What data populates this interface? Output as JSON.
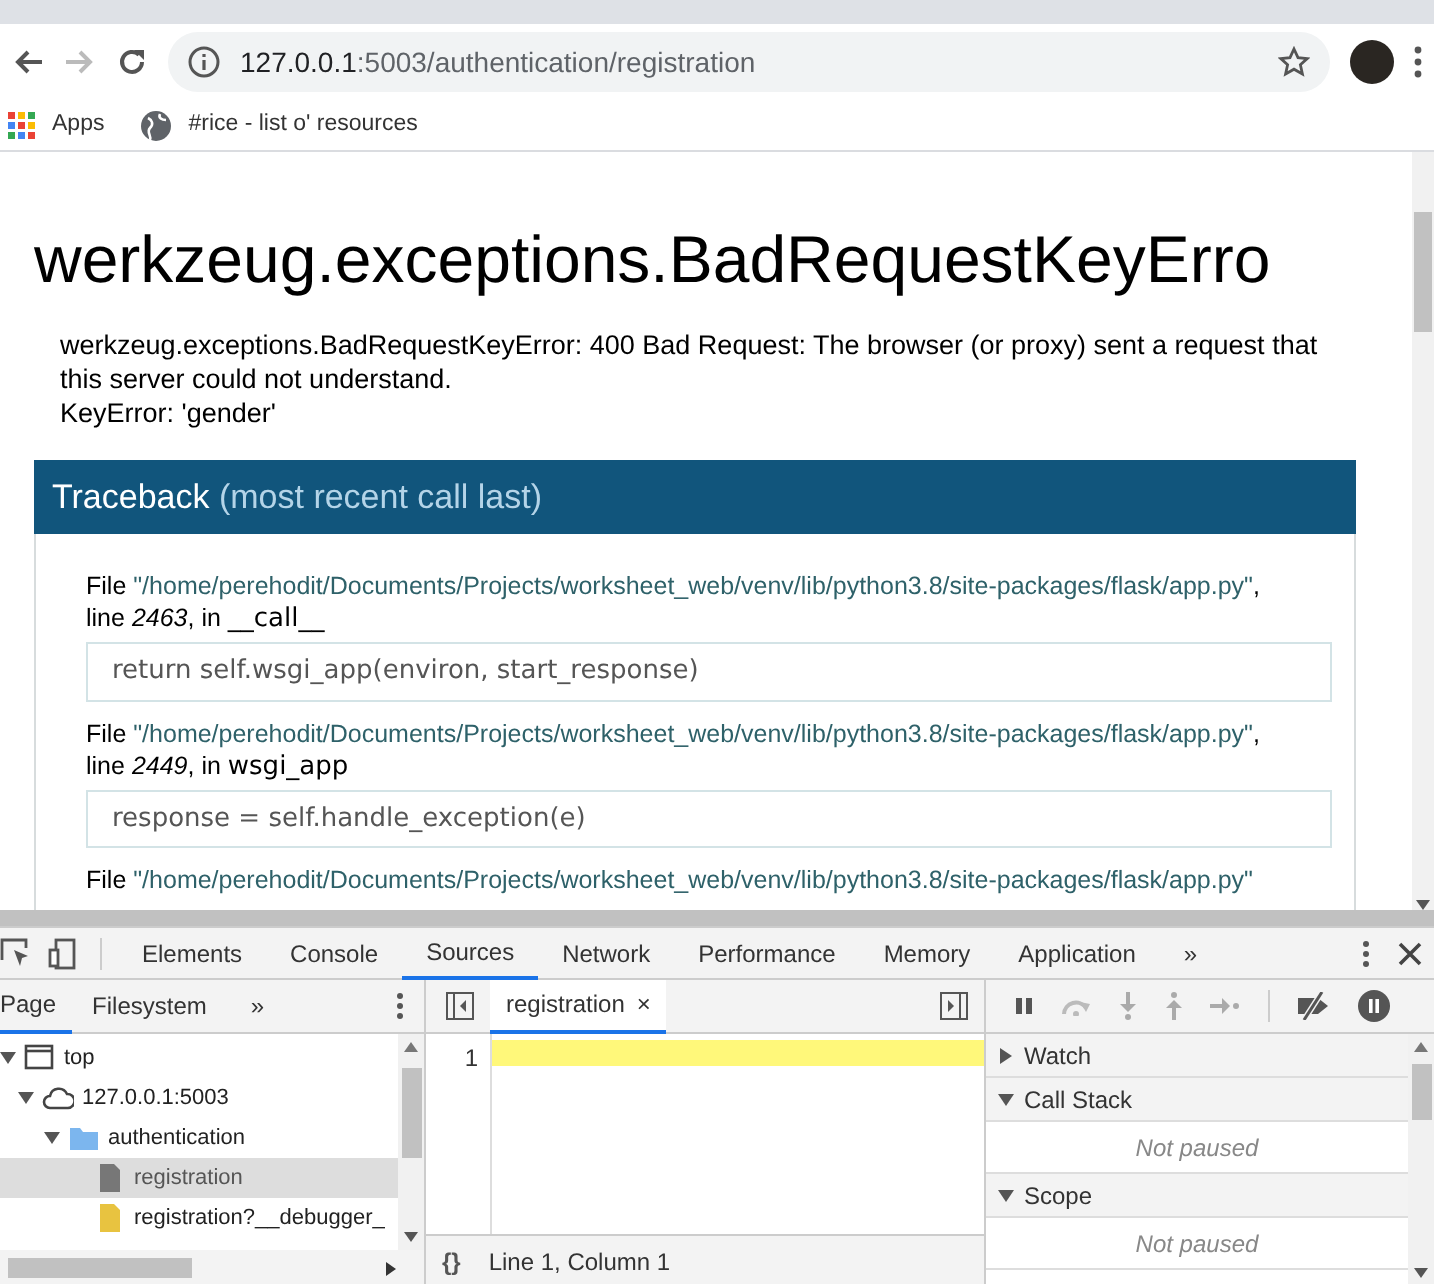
{
  "browser": {
    "url_host": "127.0.0.1",
    "url_rest": ":5003/authentication/registration",
    "bookmarks": [
      {
        "kind": "apps",
        "label": "Apps"
      },
      {
        "kind": "globe",
        "label": "#rice - list o' resources"
      }
    ]
  },
  "page": {
    "title": "werkzeug.exceptions.BadRequestKeyErro",
    "message": [
      "werkzeug.exceptions.BadRequestKeyError: 400 Bad Request: The browser (or proxy) sent a request that this server could not understand.",
      "KeyError: 'gender'"
    ],
    "traceback": {
      "heading": "Traceback",
      "note": "(most recent call last)",
      "frames": [
        {
          "file_label": "File",
          "path": "\"/home/perehodit/Documents/Projects/worksheet_web/venv/lib/python3.8/site-packages/flask/app.py\"",
          "line_label": ", line",
          "line": "2463",
          "in_label": ", in",
          "function": "__call__",
          "code": "return self.wsgi_app(environ, start_response)"
        },
        {
          "file_label": "File",
          "path": "\"/home/perehodit/Documents/Projects/worksheet_web/venv/lib/python3.8/site-packages/flask/app.py\"",
          "line_label": ", line",
          "line": "2449",
          "in_label": ", in",
          "function": "wsgi_app",
          "code": "response = self.handle_exception(e)"
        },
        {
          "file_label": "File",
          "path": "\"/home/perehodit/Documents/Projects/worksheet_web/venv/lib/python3.8/site-packages/flask/app.py\""
        }
      ]
    }
  },
  "devtools": {
    "tabs": [
      {
        "label": "Elements",
        "selected": false
      },
      {
        "label": "Console",
        "selected": false
      },
      {
        "label": "Sources",
        "selected": true
      },
      {
        "label": "Network",
        "selected": false
      },
      {
        "label": "Performance",
        "selected": false
      },
      {
        "label": "Memory",
        "selected": false
      },
      {
        "label": "Application",
        "selected": false
      }
    ],
    "more": "»",
    "nav_tabs": [
      {
        "label": "Page",
        "selected": true
      },
      {
        "label": "Filesystem",
        "selected": false
      }
    ],
    "tree": [
      {
        "kind": "frame",
        "label": "top",
        "expanded": true,
        "selected": false,
        "children": [
          {
            "kind": "origin",
            "label": "127.0.0.1:5003",
            "expanded": true,
            "selected": false,
            "children": [
              {
                "kind": "folder",
                "label": "authentication",
                "expanded": true,
                "selected": false,
                "children": [
                  {
                    "kind": "document",
                    "label": "registration",
                    "selected": true
                  },
                  {
                    "kind": "script",
                    "label": "registration?__debugger_",
                    "selected": false
                  }
                ]
              }
            ]
          }
        ]
      }
    ],
    "editor": {
      "tab": "registration",
      "close": "×",
      "line_number": "1",
      "format": "{}",
      "position": "Line 1, Column 1"
    },
    "sections": [
      {
        "title": "Watch",
        "expanded": false
      },
      {
        "title": "Call Stack",
        "expanded": true,
        "body": "Not paused"
      },
      {
        "title": "Scope",
        "expanded": true,
        "body": "Not paused"
      }
    ]
  }
}
